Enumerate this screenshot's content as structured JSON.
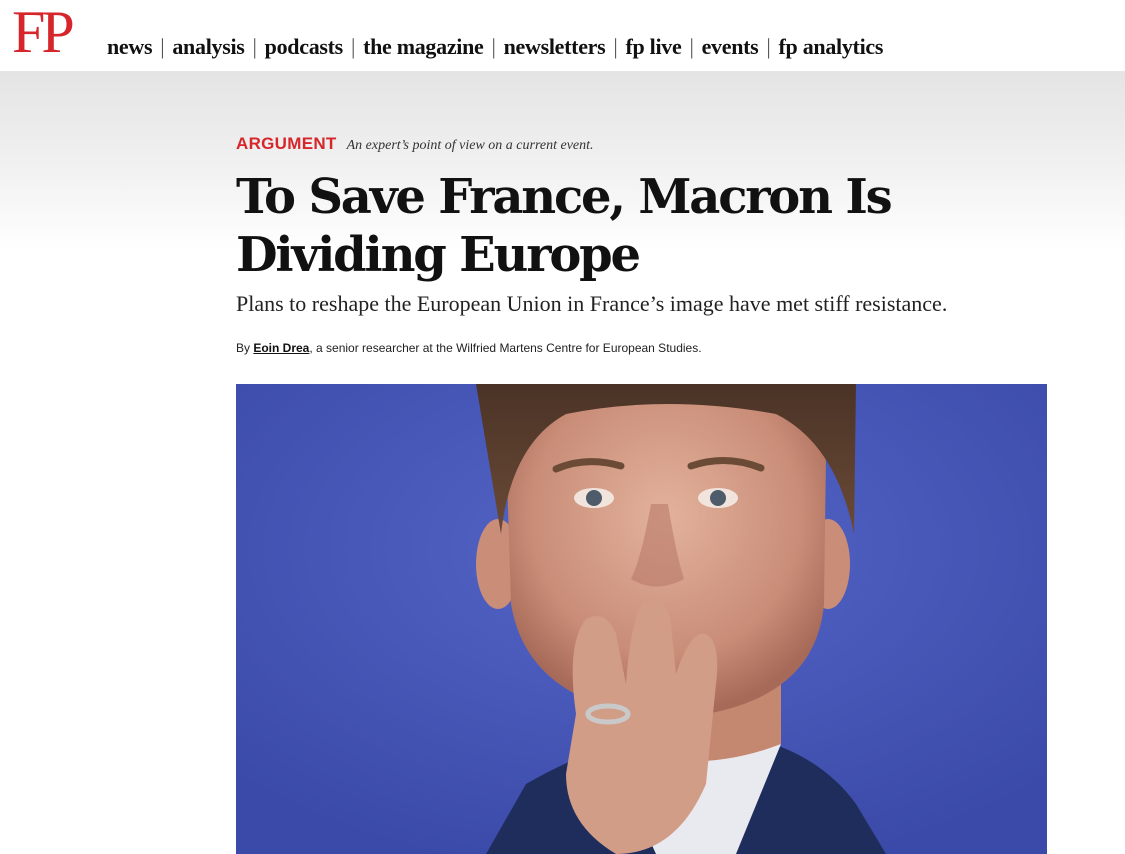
{
  "header": {
    "logo": "FP",
    "nav": [
      {
        "label": "news"
      },
      {
        "label": "analysis"
      },
      {
        "label": "podcasts"
      },
      {
        "label": "the magazine"
      },
      {
        "label": "newsletters"
      },
      {
        "label": "fp live"
      },
      {
        "label": "events"
      },
      {
        "label": "fp analytics"
      }
    ],
    "separator": "|"
  },
  "article": {
    "kicker_label": "ARGUMENT",
    "kicker_desc": "An expert’s point of view on a current event.",
    "headline": "To Save France, Macron Is Dividing Europe",
    "dek": "Plans to reshape the European Union in France’s image have met stiff resistance.",
    "byline_prefix": "By ",
    "author": "Eoin Drea",
    "byline_suffix": ", a senior researcher at the Wilfried Martens Centre for European Studies."
  },
  "colors": {
    "brand_red": "#d6262b",
    "photo_background": "#4a5cc0"
  }
}
